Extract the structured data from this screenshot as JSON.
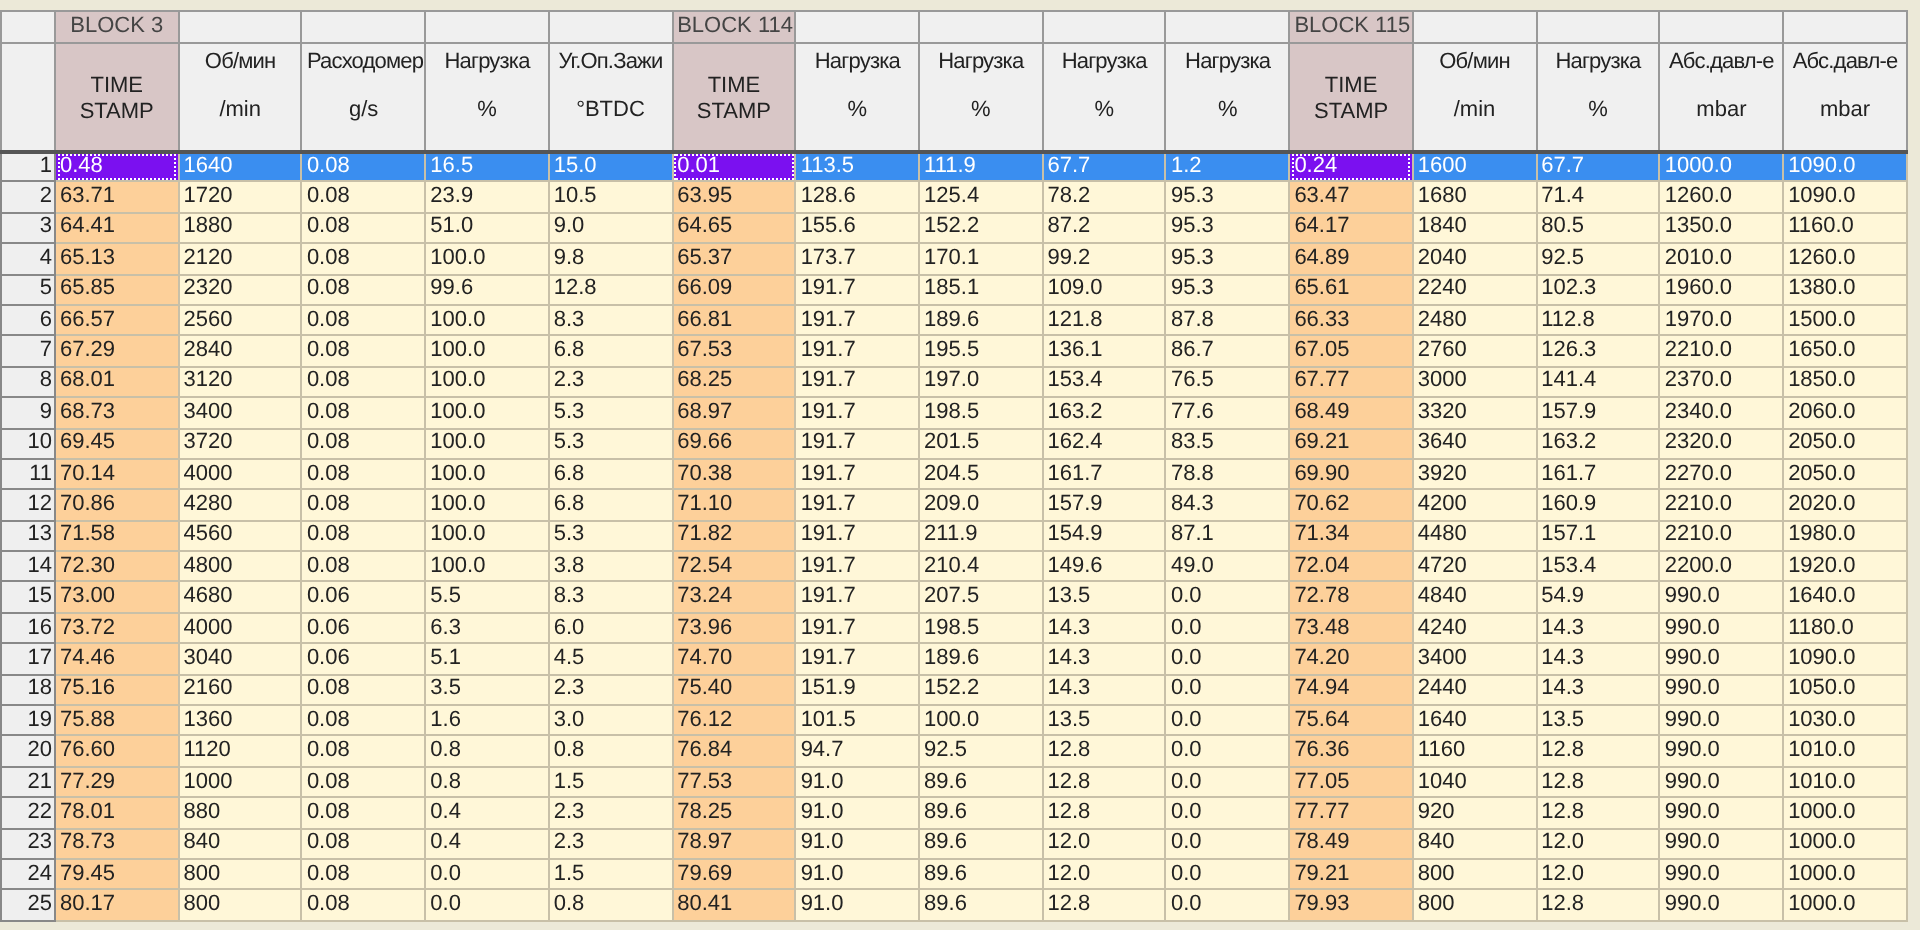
{
  "columns": [
    {
      "kind": "timestamp",
      "block": "BLOCK 3",
      "name": "TIME STAMP"
    },
    {
      "kind": "value",
      "name": "Об/мин",
      "unit": "/min"
    },
    {
      "kind": "value",
      "name": "Расходомер",
      "unit": "g/s"
    },
    {
      "kind": "value",
      "name": "Нагрузка",
      "unit": "%"
    },
    {
      "kind": "value",
      "name": "Уг.Оп.Зажи",
      "unit": "°BTDC"
    },
    {
      "kind": "timestamp",
      "block": "BLOCK 114",
      "name": "TIME STAMP"
    },
    {
      "kind": "value",
      "name": "Нагрузка",
      "unit": "%"
    },
    {
      "kind": "value",
      "name": "Нагрузка",
      "unit": "%"
    },
    {
      "kind": "value",
      "name": "Нагрузка",
      "unit": "%"
    },
    {
      "kind": "value",
      "name": "Нагрузка",
      "unit": "%"
    },
    {
      "kind": "timestamp",
      "block": "BLOCK 115",
      "name": "TIME STAMP"
    },
    {
      "kind": "value",
      "name": "Об/мин",
      "unit": "/min"
    },
    {
      "kind": "value",
      "name": "Нагрузка",
      "unit": "%"
    },
    {
      "kind": "value",
      "name": "Абс.давл-е",
      "unit": "mbar"
    },
    {
      "kind": "value",
      "name": "Абс.давл-е",
      "unit": "mbar"
    }
  ],
  "rows": [
    {
      "number": "1",
      "selected": true,
      "cells": [
        "0.48",
        "1640",
        "0.08",
        "16.5",
        "15.0",
        "0.01",
        "113.5",
        "111.9",
        "67.7",
        "1.2",
        "0.24",
        "1600",
        "67.7",
        "1000.0",
        "1090.0"
      ]
    },
    {
      "number": "2",
      "selected": false,
      "cells": [
        "63.71",
        "1720",
        "0.08",
        "23.9",
        "10.5",
        "63.95",
        "128.6",
        "125.4",
        "78.2",
        "95.3",
        "63.47",
        "1680",
        "71.4",
        "1260.0",
        "1090.0"
      ]
    },
    {
      "number": "3",
      "selected": false,
      "cells": [
        "64.41",
        "1880",
        "0.08",
        "51.0",
        "9.0",
        "64.65",
        "155.6",
        "152.2",
        "87.2",
        "95.3",
        "64.17",
        "1840",
        "80.5",
        "1350.0",
        "1160.0"
      ]
    },
    {
      "number": "4",
      "selected": false,
      "cells": [
        "65.13",
        "2120",
        "0.08",
        "100.0",
        "9.8",
        "65.37",
        "173.7",
        "170.1",
        "99.2",
        "95.3",
        "64.89",
        "2040",
        "92.5",
        "2010.0",
        "1260.0"
      ]
    },
    {
      "number": "5",
      "selected": false,
      "cells": [
        "65.85",
        "2320",
        "0.08",
        "99.6",
        "12.8",
        "66.09",
        "191.7",
        "185.1",
        "109.0",
        "95.3",
        "65.61",
        "2240",
        "102.3",
        "1960.0",
        "1380.0"
      ]
    },
    {
      "number": "6",
      "selected": false,
      "cells": [
        "66.57",
        "2560",
        "0.08",
        "100.0",
        "8.3",
        "66.81",
        "191.7",
        "189.6",
        "121.8",
        "87.8",
        "66.33",
        "2480",
        "112.8",
        "1970.0",
        "1500.0"
      ]
    },
    {
      "number": "7",
      "selected": false,
      "cells": [
        "67.29",
        "2840",
        "0.08",
        "100.0",
        "6.8",
        "67.53",
        "191.7",
        "195.5",
        "136.1",
        "86.7",
        "67.05",
        "2760",
        "126.3",
        "2210.0",
        "1650.0"
      ]
    },
    {
      "number": "8",
      "selected": false,
      "cells": [
        "68.01",
        "3120",
        "0.08",
        "100.0",
        "2.3",
        "68.25",
        "191.7",
        "197.0",
        "153.4",
        "76.5",
        "67.77",
        "3000",
        "141.4",
        "2370.0",
        "1850.0"
      ]
    },
    {
      "number": "9",
      "selected": false,
      "cells": [
        "68.73",
        "3400",
        "0.08",
        "100.0",
        "5.3",
        "68.97",
        "191.7",
        "198.5",
        "163.2",
        "77.6",
        "68.49",
        "3320",
        "157.9",
        "2340.0",
        "2060.0"
      ]
    },
    {
      "number": "10",
      "selected": false,
      "cells": [
        "69.45",
        "3720",
        "0.08",
        "100.0",
        "5.3",
        "69.66",
        "191.7",
        "201.5",
        "162.4",
        "83.5",
        "69.21",
        "3640",
        "163.2",
        "2320.0",
        "2050.0"
      ]
    },
    {
      "number": "11",
      "selected": false,
      "cells": [
        "70.14",
        "4000",
        "0.08",
        "100.0",
        "6.8",
        "70.38",
        "191.7",
        "204.5",
        "161.7",
        "78.8",
        "69.90",
        "3920",
        "161.7",
        "2270.0",
        "2050.0"
      ]
    },
    {
      "number": "12",
      "selected": false,
      "cells": [
        "70.86",
        "4280",
        "0.08",
        "100.0",
        "6.8",
        "71.10",
        "191.7",
        "209.0",
        "157.9",
        "84.3",
        "70.62",
        "4200",
        "160.9",
        "2210.0",
        "2020.0"
      ]
    },
    {
      "number": "13",
      "selected": false,
      "cells": [
        "71.58",
        "4560",
        "0.08",
        "100.0",
        "5.3",
        "71.82",
        "191.7",
        "211.9",
        "154.9",
        "87.1",
        "71.34",
        "4480",
        "157.1",
        "2210.0",
        "1980.0"
      ]
    },
    {
      "number": "14",
      "selected": false,
      "cells": [
        "72.30",
        "4800",
        "0.08",
        "100.0",
        "3.8",
        "72.54",
        "191.7",
        "210.4",
        "149.6",
        "49.0",
        "72.04",
        "4720",
        "153.4",
        "2200.0",
        "1920.0"
      ]
    },
    {
      "number": "15",
      "selected": false,
      "cells": [
        "73.00",
        "4680",
        "0.06",
        "5.5",
        "8.3",
        "73.24",
        "191.7",
        "207.5",
        "13.5",
        "0.0",
        "72.78",
        "4840",
        "54.9",
        "990.0",
        "1640.0"
      ]
    },
    {
      "number": "16",
      "selected": false,
      "cells": [
        "73.72",
        "4000",
        "0.06",
        "6.3",
        "6.0",
        "73.96",
        "191.7",
        "198.5",
        "14.3",
        "0.0",
        "73.48",
        "4240",
        "14.3",
        "990.0",
        "1180.0"
      ]
    },
    {
      "number": "17",
      "selected": false,
      "cells": [
        "74.46",
        "3040",
        "0.06",
        "5.1",
        "4.5",
        "74.70",
        "191.7",
        "189.6",
        "14.3",
        "0.0",
        "74.20",
        "3400",
        "14.3",
        "990.0",
        "1090.0"
      ]
    },
    {
      "number": "18",
      "selected": false,
      "cells": [
        "75.16",
        "2160",
        "0.08",
        "3.5",
        "2.3",
        "75.40",
        "151.9",
        "152.2",
        "14.3",
        "0.0",
        "74.94",
        "2440",
        "14.3",
        "990.0",
        "1050.0"
      ]
    },
    {
      "number": "19",
      "selected": false,
      "cells": [
        "75.88",
        "1360",
        "0.08",
        "1.6",
        "3.0",
        "76.12",
        "101.5",
        "100.0",
        "13.5",
        "0.0",
        "75.64",
        "1640",
        "13.5",
        "990.0",
        "1030.0"
      ]
    },
    {
      "number": "20",
      "selected": false,
      "cells": [
        "76.60",
        "1120",
        "0.08",
        "0.8",
        "0.8",
        "76.84",
        "94.7",
        "92.5",
        "12.8",
        "0.0",
        "76.36",
        "1160",
        "12.8",
        "990.0",
        "1010.0"
      ]
    },
    {
      "number": "21",
      "selected": false,
      "cells": [
        "77.29",
        "1000",
        "0.08",
        "0.8",
        "1.5",
        "77.53",
        "91.0",
        "89.6",
        "12.8",
        "0.0",
        "77.05",
        "1040",
        "12.8",
        "990.0",
        "1010.0"
      ]
    },
    {
      "number": "22",
      "selected": false,
      "cells": [
        "78.01",
        "880",
        "0.08",
        "0.4",
        "2.3",
        "78.25",
        "91.0",
        "89.6",
        "12.8",
        "0.0",
        "77.77",
        "920",
        "12.8",
        "990.0",
        "1000.0"
      ]
    },
    {
      "number": "23",
      "selected": false,
      "cells": [
        "78.73",
        "840",
        "0.08",
        "0.4",
        "2.3",
        "78.97",
        "91.0",
        "89.6",
        "12.0",
        "0.0",
        "78.49",
        "840",
        "12.0",
        "990.0",
        "1000.0"
      ]
    },
    {
      "number": "24",
      "selected": false,
      "cells": [
        "79.45",
        "800",
        "0.08",
        "0.0",
        "1.5",
        "79.69",
        "91.0",
        "89.6",
        "12.0",
        "0.0",
        "79.21",
        "800",
        "12.0",
        "990.0",
        "1000.0"
      ]
    },
    {
      "number": "25",
      "selected": false,
      "cells": [
        "80.17",
        "800",
        "0.08",
        "0.0",
        "0.8",
        "80.41",
        "91.0",
        "89.6",
        "12.8",
        "0.0",
        "79.93",
        "800",
        "12.8",
        "990.0",
        "1000.0"
      ]
    }
  ]
}
